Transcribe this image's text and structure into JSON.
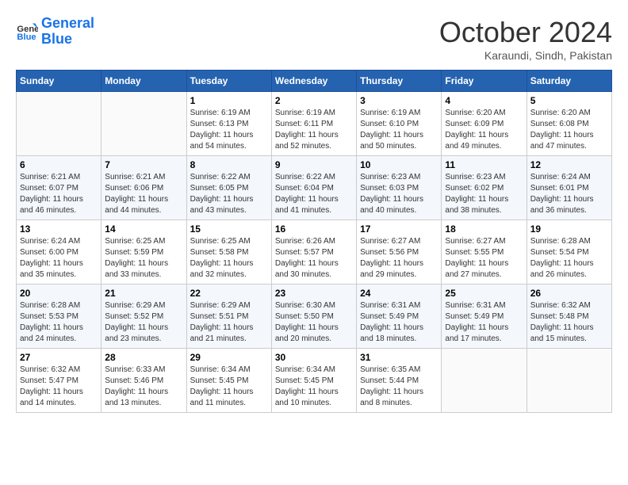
{
  "header": {
    "logo_line1": "General",
    "logo_line2": "Blue",
    "month": "October 2024",
    "location": "Karaundi, Sindh, Pakistan"
  },
  "weekdays": [
    "Sunday",
    "Monday",
    "Tuesday",
    "Wednesday",
    "Thursday",
    "Friday",
    "Saturday"
  ],
  "weeks": [
    [
      {
        "day": "",
        "empty": true
      },
      {
        "day": "",
        "empty": true
      },
      {
        "day": "1",
        "sunrise": "Sunrise: 6:19 AM",
        "sunset": "Sunset: 6:13 PM",
        "daylight": "Daylight: 11 hours and 54 minutes."
      },
      {
        "day": "2",
        "sunrise": "Sunrise: 6:19 AM",
        "sunset": "Sunset: 6:11 PM",
        "daylight": "Daylight: 11 hours and 52 minutes."
      },
      {
        "day": "3",
        "sunrise": "Sunrise: 6:19 AM",
        "sunset": "Sunset: 6:10 PM",
        "daylight": "Daylight: 11 hours and 50 minutes."
      },
      {
        "day": "4",
        "sunrise": "Sunrise: 6:20 AM",
        "sunset": "Sunset: 6:09 PM",
        "daylight": "Daylight: 11 hours and 49 minutes."
      },
      {
        "day": "5",
        "sunrise": "Sunrise: 6:20 AM",
        "sunset": "Sunset: 6:08 PM",
        "daylight": "Daylight: 11 hours and 47 minutes."
      }
    ],
    [
      {
        "day": "6",
        "sunrise": "Sunrise: 6:21 AM",
        "sunset": "Sunset: 6:07 PM",
        "daylight": "Daylight: 11 hours and 46 minutes."
      },
      {
        "day": "7",
        "sunrise": "Sunrise: 6:21 AM",
        "sunset": "Sunset: 6:06 PM",
        "daylight": "Daylight: 11 hours and 44 minutes."
      },
      {
        "day": "8",
        "sunrise": "Sunrise: 6:22 AM",
        "sunset": "Sunset: 6:05 PM",
        "daylight": "Daylight: 11 hours and 43 minutes."
      },
      {
        "day": "9",
        "sunrise": "Sunrise: 6:22 AM",
        "sunset": "Sunset: 6:04 PM",
        "daylight": "Daylight: 11 hours and 41 minutes."
      },
      {
        "day": "10",
        "sunrise": "Sunrise: 6:23 AM",
        "sunset": "Sunset: 6:03 PM",
        "daylight": "Daylight: 11 hours and 40 minutes."
      },
      {
        "day": "11",
        "sunrise": "Sunrise: 6:23 AM",
        "sunset": "Sunset: 6:02 PM",
        "daylight": "Daylight: 11 hours and 38 minutes."
      },
      {
        "day": "12",
        "sunrise": "Sunrise: 6:24 AM",
        "sunset": "Sunset: 6:01 PM",
        "daylight": "Daylight: 11 hours and 36 minutes."
      }
    ],
    [
      {
        "day": "13",
        "sunrise": "Sunrise: 6:24 AM",
        "sunset": "Sunset: 6:00 PM",
        "daylight": "Daylight: 11 hours and 35 minutes."
      },
      {
        "day": "14",
        "sunrise": "Sunrise: 6:25 AM",
        "sunset": "Sunset: 5:59 PM",
        "daylight": "Daylight: 11 hours and 33 minutes."
      },
      {
        "day": "15",
        "sunrise": "Sunrise: 6:25 AM",
        "sunset": "Sunset: 5:58 PM",
        "daylight": "Daylight: 11 hours and 32 minutes."
      },
      {
        "day": "16",
        "sunrise": "Sunrise: 6:26 AM",
        "sunset": "Sunset: 5:57 PM",
        "daylight": "Daylight: 11 hours and 30 minutes."
      },
      {
        "day": "17",
        "sunrise": "Sunrise: 6:27 AM",
        "sunset": "Sunset: 5:56 PM",
        "daylight": "Daylight: 11 hours and 29 minutes."
      },
      {
        "day": "18",
        "sunrise": "Sunrise: 6:27 AM",
        "sunset": "Sunset: 5:55 PM",
        "daylight": "Daylight: 11 hours and 27 minutes."
      },
      {
        "day": "19",
        "sunrise": "Sunrise: 6:28 AM",
        "sunset": "Sunset: 5:54 PM",
        "daylight": "Daylight: 11 hours and 26 minutes."
      }
    ],
    [
      {
        "day": "20",
        "sunrise": "Sunrise: 6:28 AM",
        "sunset": "Sunset: 5:53 PM",
        "daylight": "Daylight: 11 hours and 24 minutes."
      },
      {
        "day": "21",
        "sunrise": "Sunrise: 6:29 AM",
        "sunset": "Sunset: 5:52 PM",
        "daylight": "Daylight: 11 hours and 23 minutes."
      },
      {
        "day": "22",
        "sunrise": "Sunrise: 6:29 AM",
        "sunset": "Sunset: 5:51 PM",
        "daylight": "Daylight: 11 hours and 21 minutes."
      },
      {
        "day": "23",
        "sunrise": "Sunrise: 6:30 AM",
        "sunset": "Sunset: 5:50 PM",
        "daylight": "Daylight: 11 hours and 20 minutes."
      },
      {
        "day": "24",
        "sunrise": "Sunrise: 6:31 AM",
        "sunset": "Sunset: 5:49 PM",
        "daylight": "Daylight: 11 hours and 18 minutes."
      },
      {
        "day": "25",
        "sunrise": "Sunrise: 6:31 AM",
        "sunset": "Sunset: 5:49 PM",
        "daylight": "Daylight: 11 hours and 17 minutes."
      },
      {
        "day": "26",
        "sunrise": "Sunrise: 6:32 AM",
        "sunset": "Sunset: 5:48 PM",
        "daylight": "Daylight: 11 hours and 15 minutes."
      }
    ],
    [
      {
        "day": "27",
        "sunrise": "Sunrise: 6:32 AM",
        "sunset": "Sunset: 5:47 PM",
        "daylight": "Daylight: 11 hours and 14 minutes."
      },
      {
        "day": "28",
        "sunrise": "Sunrise: 6:33 AM",
        "sunset": "Sunset: 5:46 PM",
        "daylight": "Daylight: 11 hours and 13 minutes."
      },
      {
        "day": "29",
        "sunrise": "Sunrise: 6:34 AM",
        "sunset": "Sunset: 5:45 PM",
        "daylight": "Daylight: 11 hours and 11 minutes."
      },
      {
        "day": "30",
        "sunrise": "Sunrise: 6:34 AM",
        "sunset": "Sunset: 5:45 PM",
        "daylight": "Daylight: 11 hours and 10 minutes."
      },
      {
        "day": "31",
        "sunrise": "Sunrise: 6:35 AM",
        "sunset": "Sunset: 5:44 PM",
        "daylight": "Daylight: 11 hours and 8 minutes."
      },
      {
        "day": "",
        "empty": true
      },
      {
        "day": "",
        "empty": true
      }
    ]
  ]
}
